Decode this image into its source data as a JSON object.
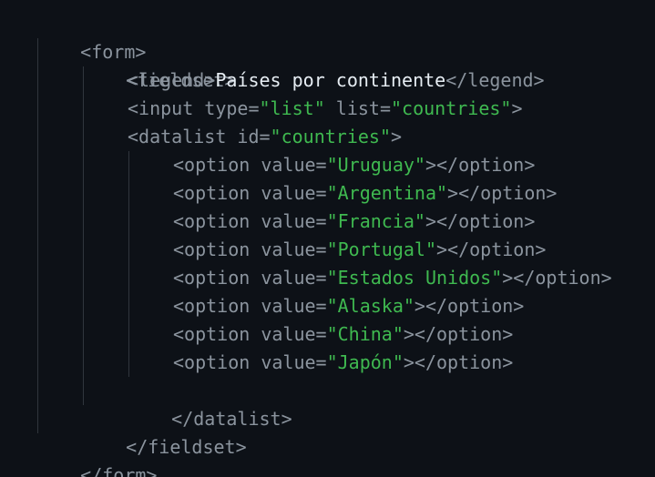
{
  "colors": {
    "background": "#0d1117",
    "tag": "#8b949e",
    "string": "#3fb950",
    "text": "#e6edf3",
    "indent_guide": "#30363d"
  },
  "code": {
    "form_open": "<form>",
    "fieldset_open": "<fieldset>",
    "legend_open": "<legend>",
    "legend_text": "Países por continente",
    "legend_close": "</legend>",
    "input_prefix": "<input type=",
    "input_type_value": "\"list\"",
    "input_list_attr": " list=",
    "input_list_value": "\"countries\"",
    "input_suffix": ">",
    "datalist_prefix": "<datalist id=",
    "datalist_id_value": "\"countries\"",
    "datalist_suffix": ">",
    "option_prefix": "<option value=",
    "option_suffix": "></option>",
    "options": [
      "\"Uruguay\"",
      "\"Argentina\"",
      "\"Francia\"",
      "\"Portugal\"",
      "\"Estados Unidos\"",
      "\"Alaska\"",
      "\"China\"",
      "\"Japón\""
    ],
    "datalist_close": "</datalist>",
    "fieldset_close": "</fieldset>",
    "form_close": "</form>"
  }
}
